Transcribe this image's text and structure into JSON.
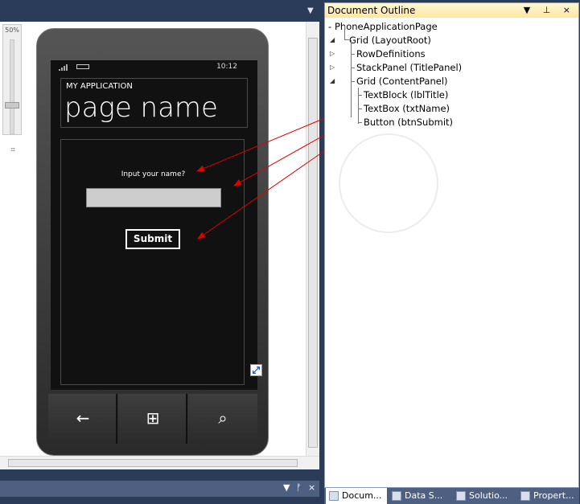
{
  "designer": {
    "zoom_level": "50%",
    "dropdown_glyph": "▼",
    "bottom_controls": {
      "dropdown": "▼",
      "pin": "ᚠ",
      "close": "×"
    }
  },
  "phone": {
    "clock": "10:12",
    "app_title": "MY APPLICATION",
    "page_title": "page name",
    "label_text": "Input your name?",
    "textbox_value": "",
    "submit_label": "Submit",
    "nav": {
      "back": "←",
      "start": "⊞",
      "search": "⌕"
    }
  },
  "outline": {
    "title": "Document Outline",
    "controls": "▼ ⊥ ×",
    "tree": [
      {
        "label": "PhoneApplicationPage",
        "level": 0
      },
      {
        "label": "Grid (LayoutRoot)",
        "level": 1,
        "expander": "◢"
      },
      {
        "label": "RowDefinitions",
        "level": 2,
        "expander": "▷"
      },
      {
        "label": "StackPanel (TitlePanel)",
        "level": 2,
        "expander": "▷"
      },
      {
        "label": "Grid (ContentPanel)",
        "level": 2,
        "expander": "◢"
      },
      {
        "label": "TextBlock (lblTitle)",
        "level": 3
      },
      {
        "label": "TextBox (txtName)",
        "level": 3
      },
      {
        "label": "Button (btnSubmit)",
        "level": 3
      }
    ],
    "tabs": [
      {
        "label": "Docum..."
      },
      {
        "label": "Data S..."
      },
      {
        "label": "Solutio..."
      },
      {
        "label": "Propert..."
      }
    ]
  }
}
